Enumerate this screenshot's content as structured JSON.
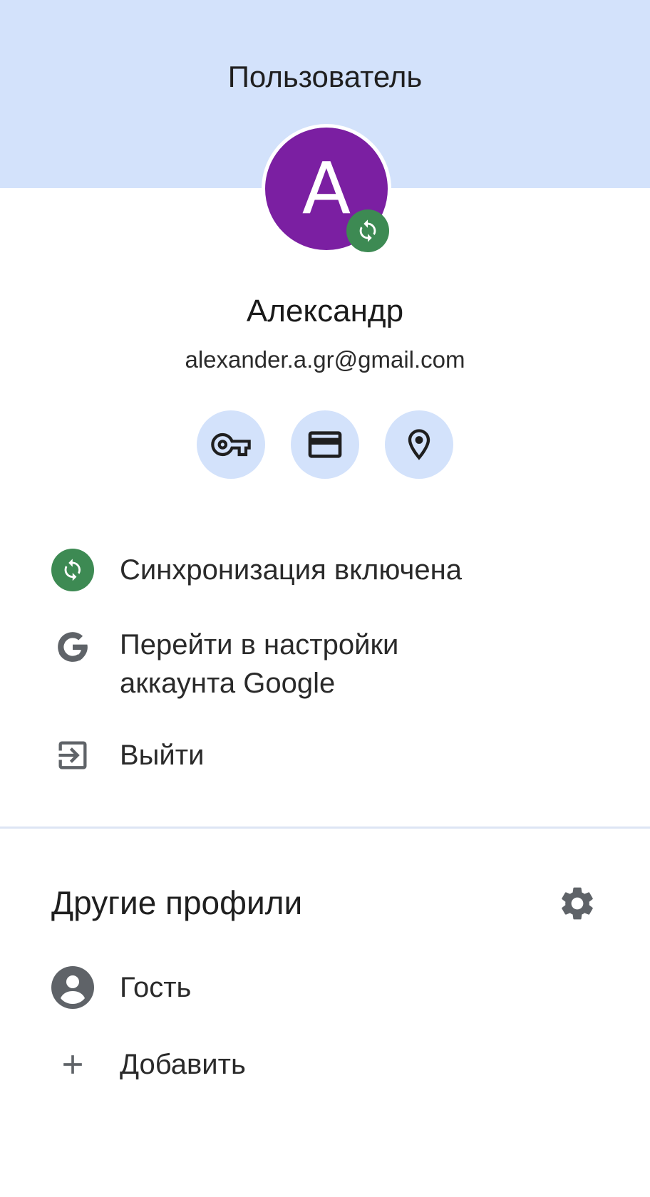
{
  "header": {
    "title": "Пользователь",
    "band_color": "#d3e2fb"
  },
  "profile": {
    "avatar_letter": "A",
    "avatar_color": "#7b1fa2",
    "sync_badge_icon": "sync-icon",
    "name": "Александр",
    "email": "alexander.a.gr@gmail.com"
  },
  "quick_actions": [
    {
      "icon": "key-icon"
    },
    {
      "icon": "credit-card-icon"
    },
    {
      "icon": "location-pin-icon"
    }
  ],
  "menu": {
    "sync": {
      "label": "Синхронизация включена",
      "icon": "sync-icon",
      "color": "#3d8a53"
    },
    "google_account": {
      "label_line1": "Перейти в настройки",
      "label_line2": "аккаунта Google",
      "icon": "google-icon"
    },
    "sign_out": {
      "label": "Выйти",
      "icon": "sign-out-icon"
    }
  },
  "other_profiles": {
    "title": "Другие профили",
    "settings_icon": "gear-icon",
    "guest": {
      "label": "Гость",
      "icon": "person-icon"
    },
    "add": {
      "label": "Добавить",
      "icon": "plus-icon"
    }
  }
}
